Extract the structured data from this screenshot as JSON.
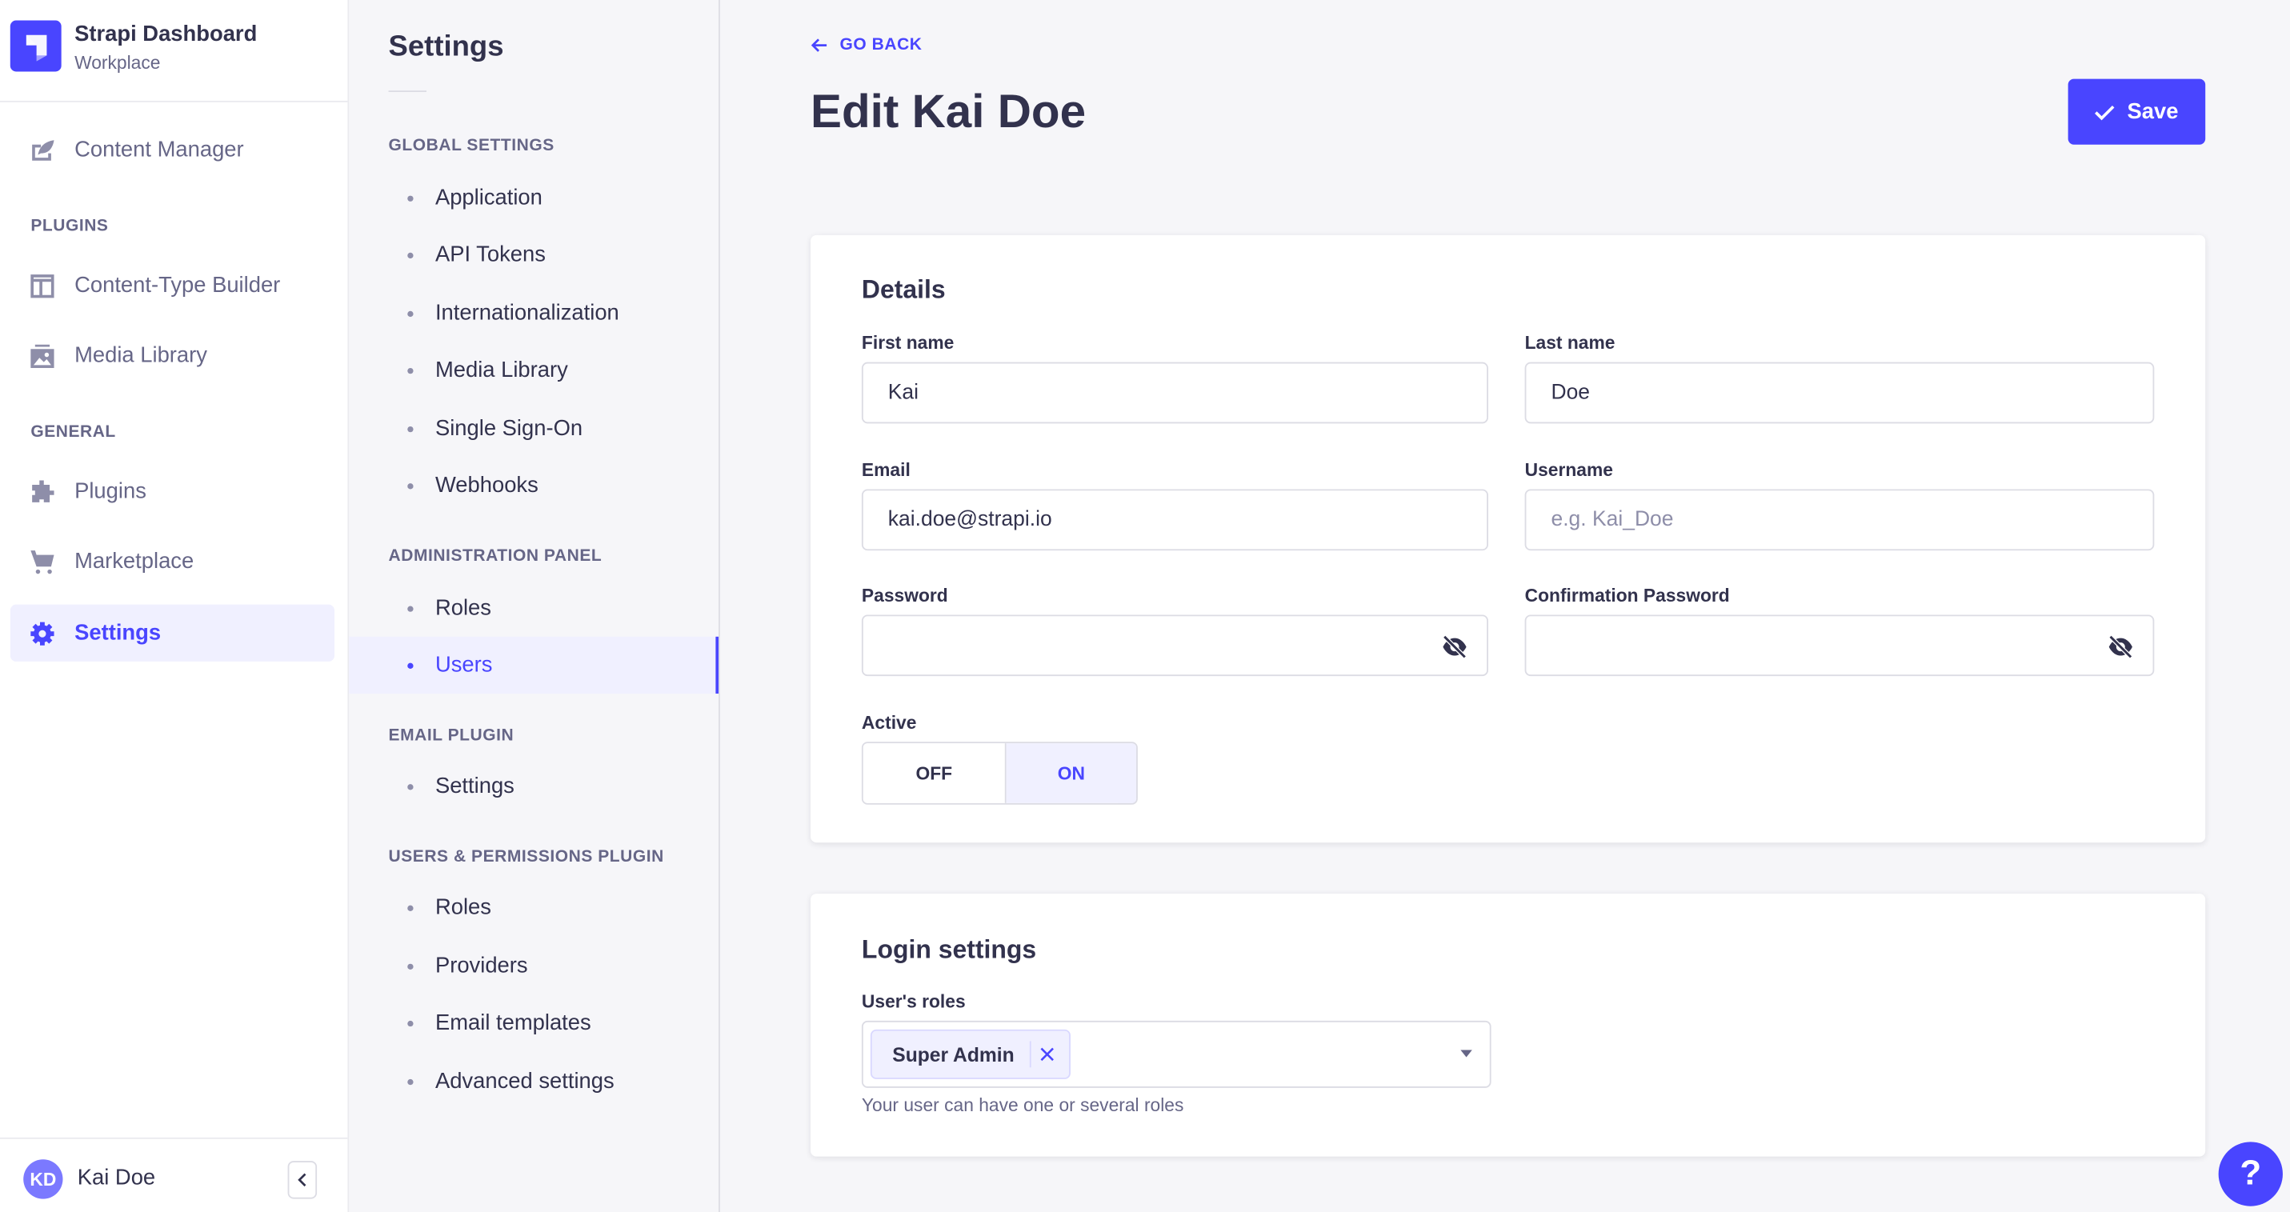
{
  "brand": {
    "title": "Strapi Dashboard",
    "subtitle": "Workplace"
  },
  "nav": {
    "content_manager": "Content Manager",
    "plugins_heading": "PLUGINS",
    "content_type_builder": "Content-Type Builder",
    "media_library": "Media Library",
    "general_heading": "GENERAL",
    "plugins": "Plugins",
    "marketplace": "Marketplace",
    "settings": "Settings"
  },
  "user": {
    "initials": "KD",
    "name": "Kai Doe"
  },
  "subnav": {
    "title": "Settings",
    "sections": [
      {
        "heading": "GLOBAL SETTINGS",
        "items": [
          "Application",
          "API Tokens",
          "Internationalization",
          "Media Library",
          "Single Sign-On",
          "Webhooks"
        ]
      },
      {
        "heading": "ADMINISTRATION PANEL",
        "items": [
          "Roles",
          "Users"
        ]
      },
      {
        "heading": "EMAIL PLUGIN",
        "items": [
          "Settings"
        ]
      },
      {
        "heading": "USERS & PERMISSIONS PLUGIN",
        "items": [
          "Roles",
          "Providers",
          "Email templates",
          "Advanced settings"
        ]
      }
    ],
    "active": "Users"
  },
  "header": {
    "go_back": "GO BACK",
    "title": "Edit Kai Doe",
    "save": "Save"
  },
  "details": {
    "title": "Details",
    "first_name": {
      "label": "First name",
      "value": "Kai"
    },
    "last_name": {
      "label": "Last name",
      "value": "Doe"
    },
    "email": {
      "label": "Email",
      "value": "kai.doe@strapi.io"
    },
    "username": {
      "label": "Username",
      "value": "",
      "placeholder": "e.g. Kai_Doe"
    },
    "password": {
      "label": "Password",
      "value": ""
    },
    "confirm_password": {
      "label": "Confirmation Password",
      "value": ""
    },
    "active": {
      "label": "Active",
      "off": "OFF",
      "on": "ON",
      "selected": "ON"
    }
  },
  "login": {
    "title": "Login settings",
    "roles_label": "User's roles",
    "roles": [
      "Super Admin"
    ],
    "hint": "Your user can have one or several roles"
  },
  "help": "?",
  "colors": {
    "primary": "#4945ff",
    "text": "#32324d",
    "muted": "#666687",
    "bg": "#f6f6f9"
  }
}
